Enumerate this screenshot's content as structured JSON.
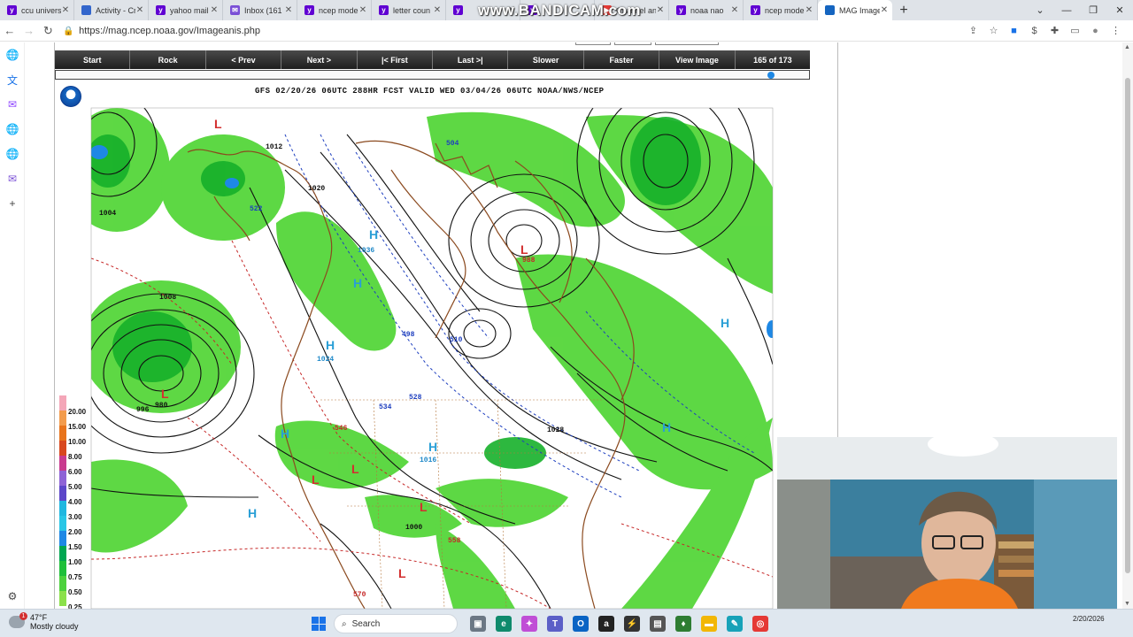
{
  "browser": {
    "tabs": [
      {
        "label": "ccu universi",
        "icon": "yahoo-icon",
        "color": "#6001d2"
      },
      {
        "label": "Activity - Cr",
        "icon": "canvas-icon",
        "color": "#3366cc"
      },
      {
        "label": "yahoo mail",
        "icon": "yahoo-icon",
        "color": "#6001d2"
      },
      {
        "label": "Inbox (161",
        "icon": "mail-icon",
        "color": "#7a4fd6"
      },
      {
        "label": "ncep mode",
        "icon": "yahoo-icon",
        "color": "#6001d2"
      },
      {
        "label": "letter coun",
        "icon": "yahoo-icon",
        "color": "#6001d2"
      },
      {
        "label": "",
        "icon": "yahoo-icon",
        "color": "#6001d2"
      },
      {
        "label": "",
        "icon": "yahoo-icon",
        "color": "#6001d2"
      },
      {
        "label": "Channel an",
        "icon": "youtube-icon",
        "color": "#e53935"
      },
      {
        "label": "noaa nao",
        "icon": "yahoo-icon",
        "color": "#6001d2"
      },
      {
        "label": "ncep mode",
        "icon": "yahoo-icon",
        "color": "#6001d2"
      },
      {
        "label": "MAG Image",
        "icon": "globe-icon",
        "color": "#1565c0",
        "active": true
      }
    ],
    "watermark": "www.BANDICAM.com",
    "url": "https://mag.ncep.noaa.gov/Imageanis.php"
  },
  "controls": {
    "buttons": [
      "Start",
      "Rock",
      "< Prev",
      "Next >",
      "|< First",
      "Last >|",
      "Slower",
      "Faster",
      "View Image"
    ],
    "frame_counter": "165 of 173",
    "frame_current": 165,
    "frame_total": 173
  },
  "map": {
    "title": "GFS 02/20/26 06UTC 288HR FCST VALID WED 03/04/26 06UTC NOAA/NWS/NCEP",
    "legend": [
      {
        "label": "20.00",
        "color": "#f4a6b8"
      },
      {
        "label": "15.00",
        "color": "#f39c4d"
      },
      {
        "label": "10.00",
        "color": "#e8741c"
      },
      {
        "label": "8.00",
        "color": "#d8481f"
      },
      {
        "label": "6.00",
        "color": "#c93b8f"
      },
      {
        "label": "5.00",
        "color": "#8e63d6"
      },
      {
        "label": "4.00",
        "color": "#5c46c9"
      },
      {
        "label": "3.00",
        "color": "#1fb7e0"
      },
      {
        "label": "2.00",
        "color": "#28c6e6"
      },
      {
        "label": "1.50",
        "color": "#1e88e5"
      },
      {
        "label": "1.00",
        "color": "#00a651"
      },
      {
        "label": "0.75",
        "color": "#1fbf3a"
      },
      {
        "label": "0.50",
        "color": "#4dd13d"
      },
      {
        "label": "0.25",
        "color": "#8be04a"
      }
    ],
    "labels": {
      "pressure": [
        "1012",
        "1004",
        "996",
        "1020",
        "1008",
        "1024",
        "1036",
        "1028",
        "1016",
        "1000",
        "988",
        "980"
      ],
      "thickness": [
        "522",
        "528",
        "534",
        "540",
        "546",
        "552",
        "558",
        "570",
        "576",
        "510",
        "504",
        "498"
      ]
    }
  },
  "taskbar": {
    "temp": "47°F",
    "condition": "Mostly cloudy",
    "search_placeholder": "Search",
    "notification_count": "1",
    "date": "2/20/2026"
  }
}
